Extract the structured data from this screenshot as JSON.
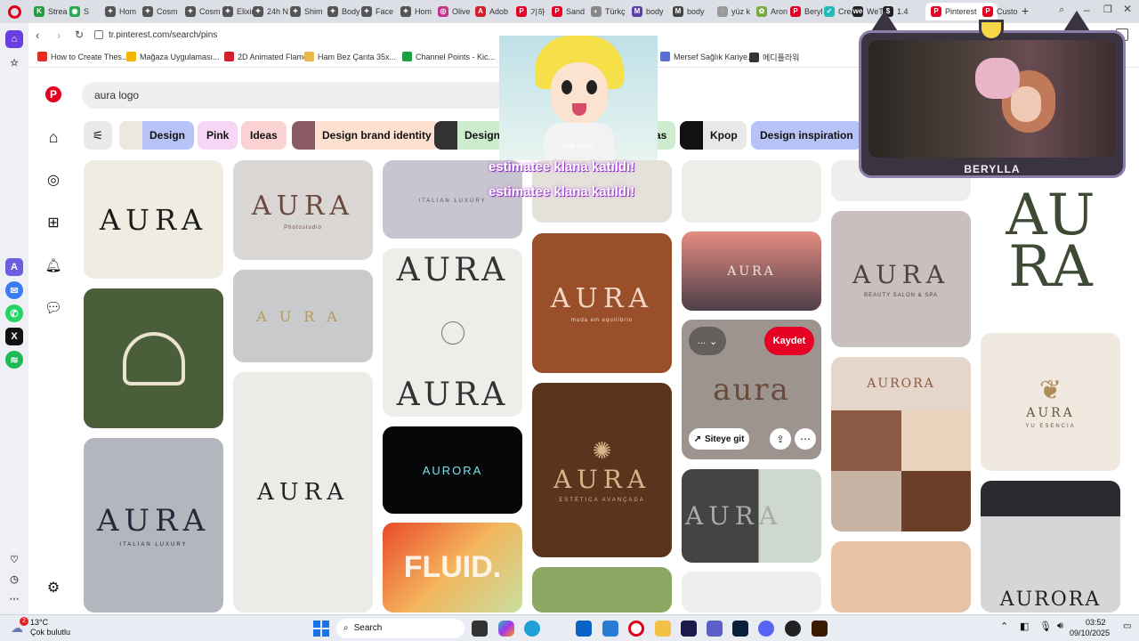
{
  "tabs": [
    {
      "label": "Strea",
      "color": "#1e9e3e",
      "glyph": "K"
    },
    {
      "label": "S",
      "color": "#2aa84f",
      "glyph": "◉"
    },
    {
      "label": "Hom",
      "color": "#555",
      "glyph": "✦"
    },
    {
      "label": "Cosm",
      "color": "#555",
      "glyph": "✦"
    },
    {
      "label": "Cosm",
      "color": "#555",
      "glyph": "✦"
    },
    {
      "label": "Elixir",
      "color": "#555",
      "glyph": "✦"
    },
    {
      "label": "24h N",
      "color": "#555",
      "glyph": "✦"
    },
    {
      "label": "Shim",
      "color": "#555",
      "glyph": "✦"
    },
    {
      "label": "Body",
      "color": "#555",
      "glyph": "✦"
    },
    {
      "label": "Face",
      "color": "#555",
      "glyph": "✦"
    },
    {
      "label": "Hom",
      "color": "#555",
      "glyph": "✦"
    },
    {
      "label": "Olive",
      "color": "#c1358e",
      "glyph": "◎"
    },
    {
      "label": "Adob",
      "color": "#d4202a",
      "glyph": "A"
    },
    {
      "label": "기하",
      "color": "#e60023",
      "glyph": "P"
    },
    {
      "label": "Sand",
      "color": "#e60023",
      "glyph": "P"
    },
    {
      "label": "Türkç",
      "color": "#888",
      "glyph": "◐"
    },
    {
      "label": "body",
      "color": "#5a3fa8",
      "glyph": "M"
    },
    {
      "label": "body",
      "color": "#444",
      "glyph": "M"
    },
    {
      "label": "yüz k",
      "color": "#999",
      "glyph": "◌"
    },
    {
      "label": "Aron",
      "color": "#7a4",
      "glyph": "✿"
    },
    {
      "label": "Beryl",
      "color": "#e60023",
      "glyph": "P"
    },
    {
      "label": "Crea",
      "color": "#2bb",
      "glyph": "✓"
    },
    {
      "label": "WeTr",
      "color": "#222",
      "glyph": "we"
    },
    {
      "label": "1.4",
      "color": "#222",
      "glyph": "$"
    },
    {
      "label": "Pinterest",
      "color": "#e60023",
      "glyph": "P",
      "active": true
    },
    {
      "label": "Custo",
      "color": "#e60023",
      "glyph": "P"
    }
  ],
  "address": {
    "url": "tr.pinterest.com/search/pins"
  },
  "bookmarks": [
    {
      "label": "How to Create Thes...",
      "color": "#e52d27"
    },
    {
      "label": "Mağaza Uygulaması...",
      "color": "#f4b400"
    },
    {
      "label": "2D Animated Flame...",
      "color": "#d4202a"
    },
    {
      "label": "Ham Bez Çanta 35x...",
      "color": "#e8b84a"
    },
    {
      "label": "Channel Points - Kic...",
      "color": "#1e9e3e"
    },
    {
      "label": "Mersef Sağlık Kariye...",
      "color": "#5a6fd0"
    },
    {
      "label": "메디플라워",
      "color": "#333"
    }
  ],
  "search": {
    "query": "aura logo"
  },
  "chips": [
    {
      "label": "Design",
      "bg": "#b7c3f7",
      "thumb": "#ece8df"
    },
    {
      "label": "Pink",
      "bg": "#f6d6f4",
      "thumb": ""
    },
    {
      "label": "Ideas",
      "bg": "#fbd2d2",
      "thumb": ""
    },
    {
      "label": "Design brand identity",
      "bg": "#fde0cf",
      "thumb": "#8a5a64"
    },
    {
      "label": "Design",
      "bg": "#cdeccd",
      "thumb": "#333"
    },
    {
      "label": "as",
      "bg": "#cdeccd",
      "thumb": ""
    },
    {
      "label": "Kpop",
      "bg": "#e8e8e8",
      "thumb": "#111"
    },
    {
      "label": "Design inspiration",
      "bg": "#b7c3f7",
      "thumb": ""
    }
  ],
  "pins": {
    "p1": {
      "text": "AURA",
      "sub": ""
    },
    "p2": {
      "text": "AURA",
      "sub": "Photostudio"
    },
    "p3": {
      "text": "",
      "sub": "ITALIAN LUXURY"
    },
    "p5": {
      "text": "AURA",
      "sub": ""
    },
    "p6": {
      "text": "AURA",
      "sub": "BEAUTY SALON & SPA"
    },
    "p7": {
      "text": "AURA",
      "sub": ""
    },
    "p8": {
      "text": "AURA",
      "sub": ""
    },
    "p9": {
      "text": "AURA",
      "sub": ""
    },
    "p10": {
      "text": "AURA",
      "sub": "moda em equilíbrio"
    },
    "p11": {
      "text": "aura",
      "sub": ""
    },
    "p12": {
      "text": "AURA",
      "sub": "YU ESENCIA"
    },
    "p13": {
      "text": "AURA",
      "sub": ""
    },
    "p14": {
      "text": "AURA",
      "sub": "ITALIAN LUXURY"
    },
    "p15": {
      "text": "AURORA",
      "sub": ""
    },
    "p16": {
      "text": "AURA",
      "sub": "ESTÉTICA AVANÇADA"
    },
    "p17": {
      "text": "AURA",
      "sub": ""
    },
    "p18": {
      "text": "FLUID.",
      "sub": ""
    },
    "p19": {
      "text": "AURORA",
      "sub": ""
    }
  },
  "pin_overlay": {
    "save": "Kaydet",
    "visit": "Siteye git",
    "more": "..."
  },
  "stream": {
    "anime_text_1": "estimatee klana katıldı!",
    "anime_text_2": "estimatee klana katıldı!",
    "anime_small": "Well done!",
    "cam_name": "BERYLLA"
  },
  "taskbar": {
    "weather_temp": "13°C",
    "weather_desc": "Çok bulutlu",
    "weather_badge": "2",
    "search": "Search",
    "time": "03:52",
    "date": "09/10/2025"
  }
}
